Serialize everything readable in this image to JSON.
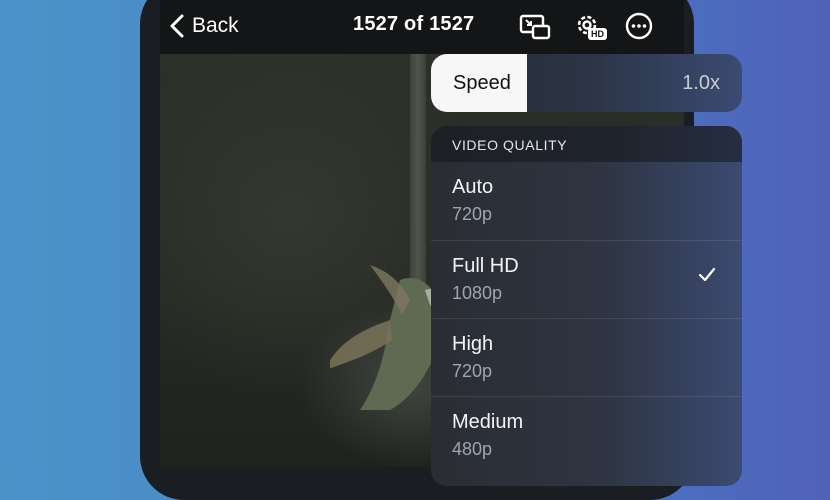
{
  "header": {
    "back_label": "Back",
    "title": "1527 of 1527",
    "icons": [
      "picture-in-picture-icon",
      "settings-hd-icon",
      "more-options-icon"
    ],
    "hd_badge": "HD"
  },
  "speed": {
    "label": "Speed",
    "value": "1.0x",
    "fill_fraction": 0.31
  },
  "quality_menu": {
    "header": "VIDEO QUALITY",
    "items": [
      {
        "name": "Auto",
        "resolution": "720p",
        "selected": false
      },
      {
        "name": "Full HD",
        "resolution": "1080p",
        "selected": true
      },
      {
        "name": "High",
        "resolution": "720p",
        "selected": false
      },
      {
        "name": "Medium",
        "resolution": "480p",
        "selected": false
      }
    ]
  },
  "colors": {
    "background": "#4a86c6",
    "menu": "#2e3442",
    "speed_fill": "#f7f7f7"
  }
}
